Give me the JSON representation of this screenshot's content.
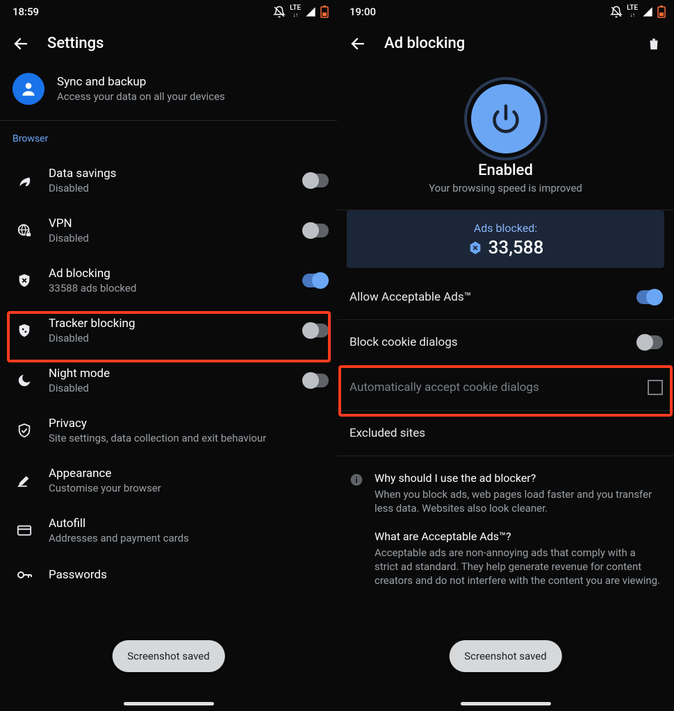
{
  "left": {
    "status_time": "18:59",
    "header_title": "Settings",
    "sync": {
      "title": "Sync and backup",
      "sub": "Access your data on all your devices"
    },
    "section": "Browser",
    "rows": {
      "data_savings": {
        "title": "Data savings",
        "sub": "Disabled"
      },
      "vpn": {
        "title": "VPN",
        "sub": "Disabled"
      },
      "ad_blocking": {
        "title": "Ad blocking",
        "sub": "33588 ads blocked"
      },
      "tracker": {
        "title": "Tracker blocking",
        "sub": "Disabled"
      },
      "night": {
        "title": "Night mode",
        "sub": "Disabled"
      },
      "privacy": {
        "title": "Privacy",
        "sub": "Site settings, data collection and exit behaviour"
      },
      "appearance": {
        "title": "Appearance",
        "sub": "Customise your browser"
      },
      "autofill": {
        "title": "Autofill",
        "sub": "Addresses and payment cards"
      },
      "passwords": {
        "title": "Passwords"
      }
    },
    "toast": "Screenshot saved"
  },
  "right": {
    "status_time": "19:00",
    "header_title": "Ad blocking",
    "enabled_title": "Enabled",
    "enabled_sub": "Your browsing speed is improved",
    "ads_card": {
      "label": "Ads blocked:",
      "count": "33,588"
    },
    "allow_ads": "Allow Acceptable Ads™",
    "block_cookie": "Block cookie dialogs",
    "auto_accept": "Automatically accept cookie dialogs",
    "excluded": "Excluded sites",
    "info1": {
      "q": "Why should I use the ad blocker?",
      "a": "When you block ads, web pages load faster and you transfer less data. Websites also look cleaner."
    },
    "info2": {
      "q": "What are Acceptable Ads™?",
      "a": "Acceptable ads are non-annoying ads that comply with a strict ad standard. They help generate revenue for content creators and do not interfere with the content you are viewing."
    },
    "toast": "Screenshot saved"
  }
}
